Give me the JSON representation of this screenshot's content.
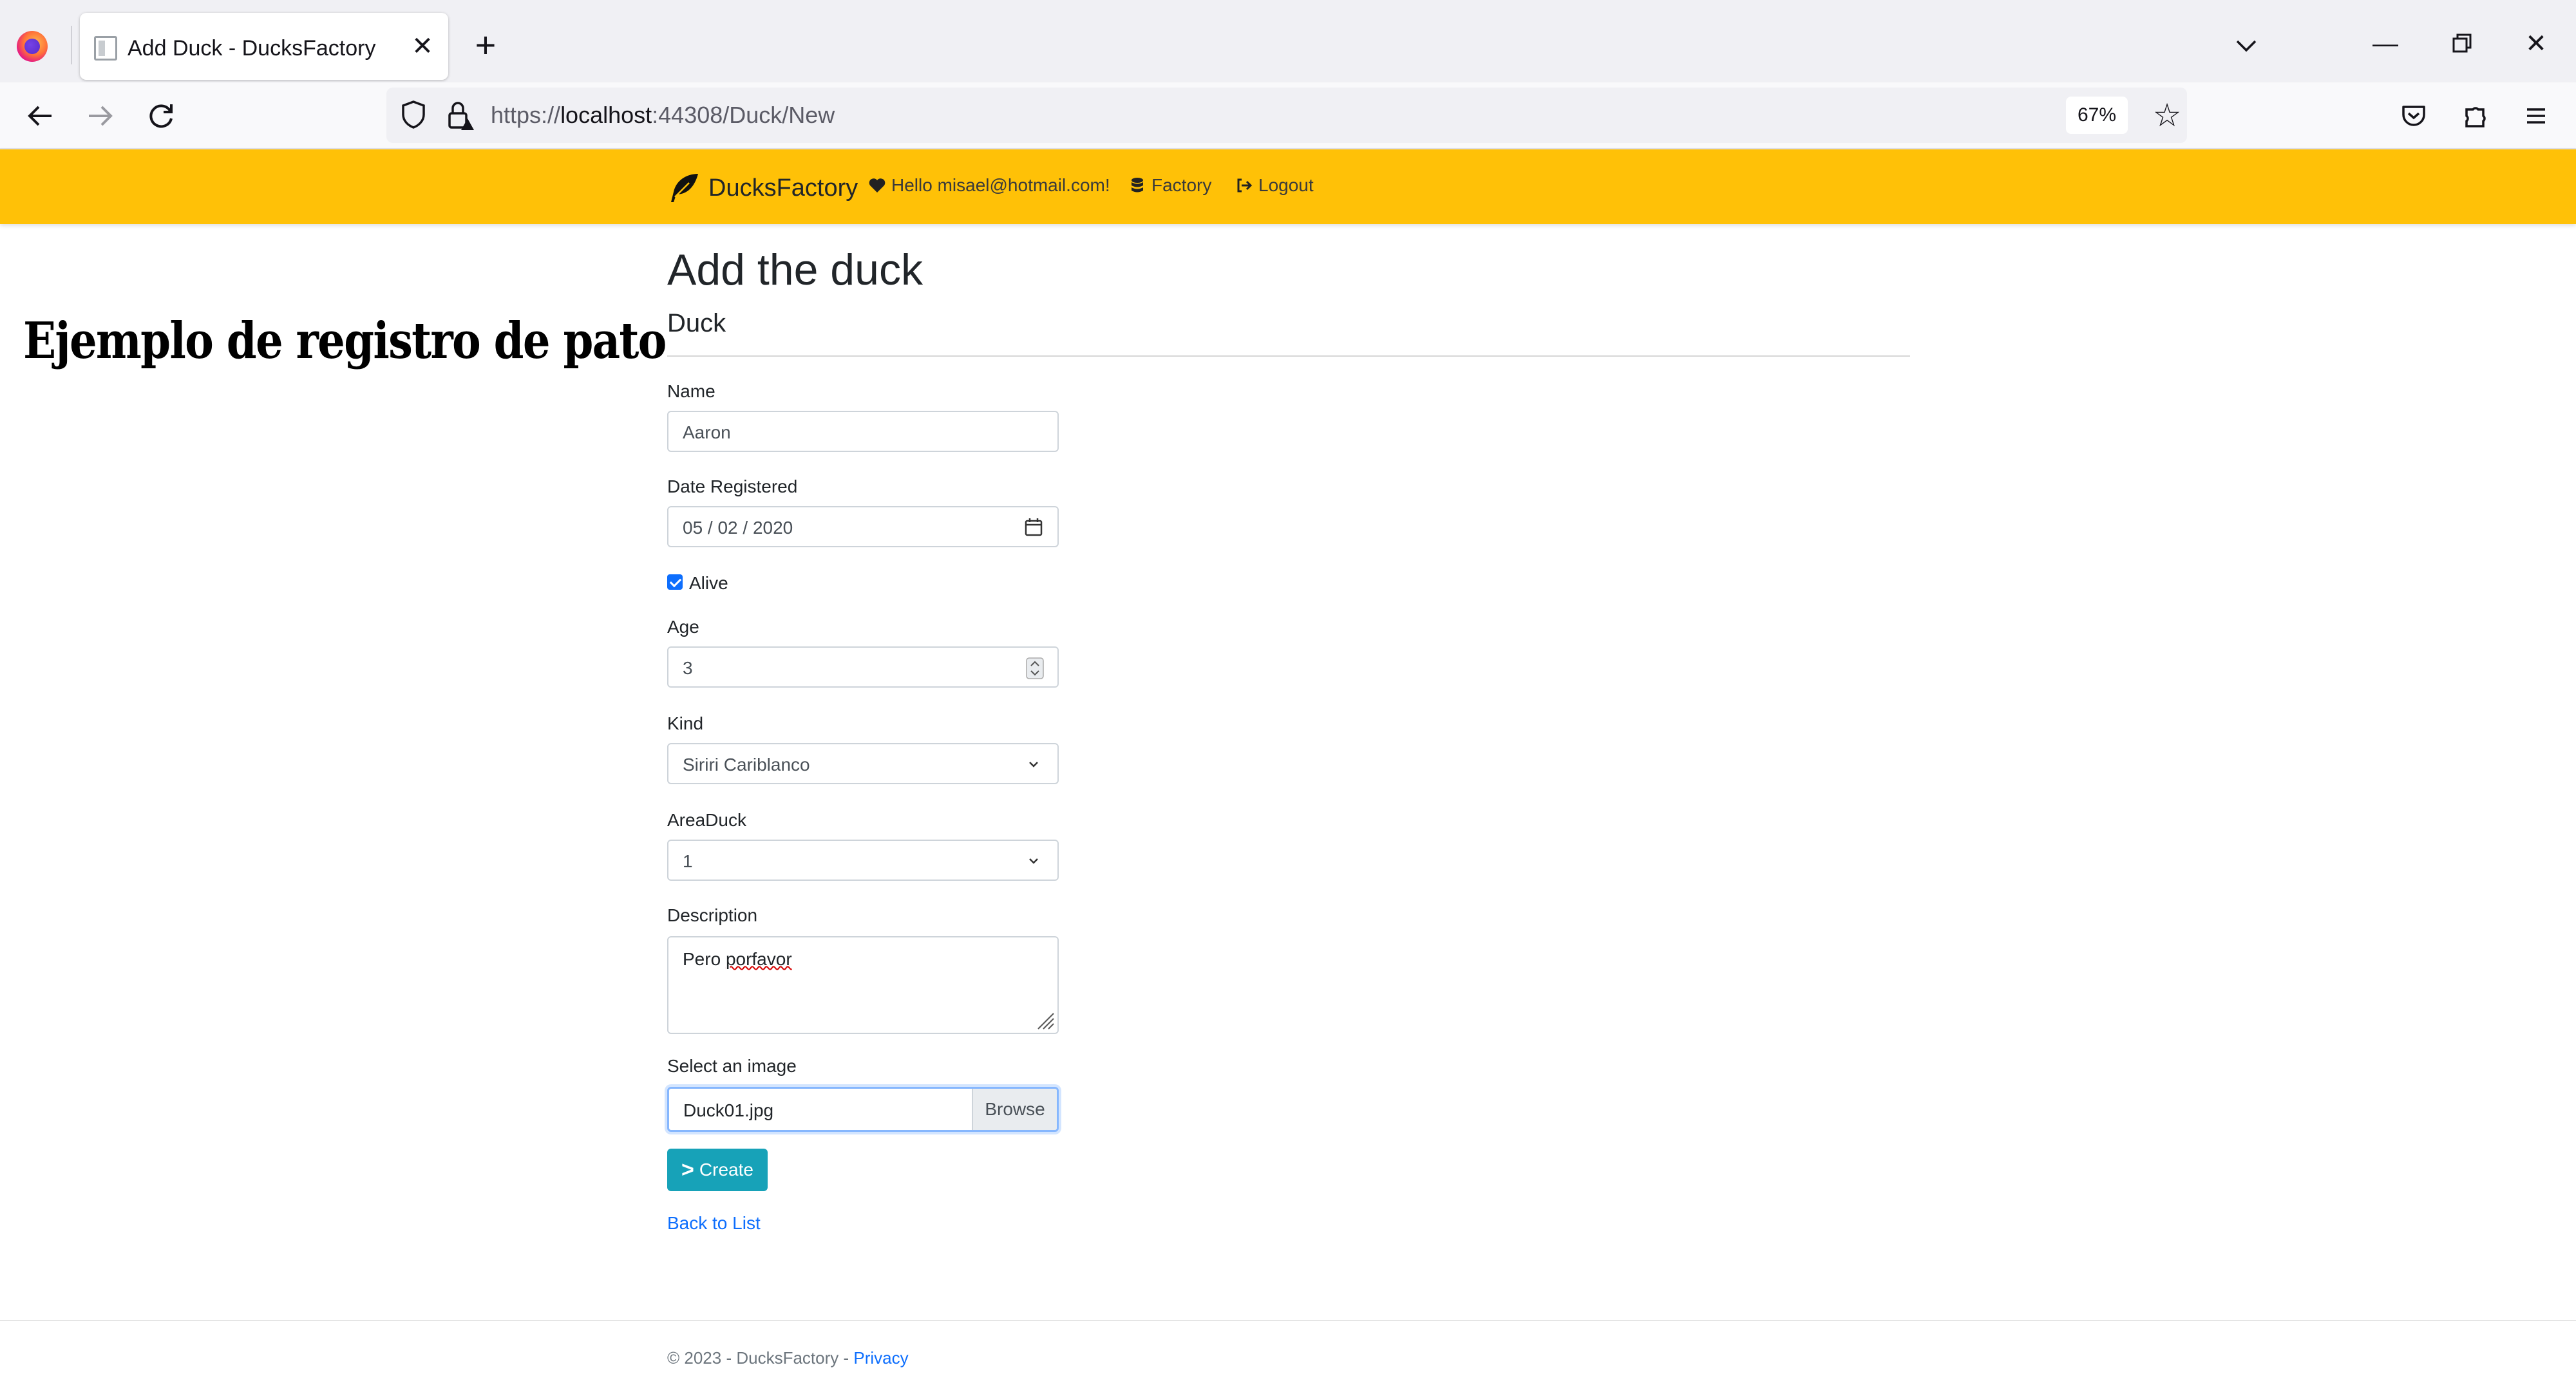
{
  "browser": {
    "tab_title": "Add Duck - DucksFactory",
    "url_prefix": "https://",
    "url_host": "localhost",
    "url_rest": ":44308/Duck/New",
    "zoom": "67%"
  },
  "header": {
    "brand": "DucksFactory",
    "hello": "Hello misael@hotmail.com!",
    "factory": "Factory",
    "logout": "Logout",
    "background_color": "#ffc107"
  },
  "caption": "Ejemplo de registro de pato",
  "form": {
    "title": "Add the duck",
    "subtitle": "Duck",
    "name_label": "Name",
    "name_value": "Aaron",
    "date_label": "Date Registered",
    "date_value": "05 / 02 / 2020",
    "alive_label": "Alive",
    "alive_checked": true,
    "age_label": "Age",
    "age_value": "3",
    "kind_label": "Kind",
    "kind_value": "Siriri Cariblanco",
    "area_label": "AreaDuck",
    "area_value": "1",
    "description_label": "Description",
    "description_word1": "Pero",
    "description_word2": "porfavor",
    "image_label": "Select an image",
    "image_value": "Duck01.jpg",
    "browse_label": "Browse",
    "create_label": "Create",
    "back_label": "Back to List",
    "button_color": "#17a2b8"
  },
  "footer": {
    "text": "© 2023 - DucksFactory - ",
    "privacy": "Privacy"
  }
}
